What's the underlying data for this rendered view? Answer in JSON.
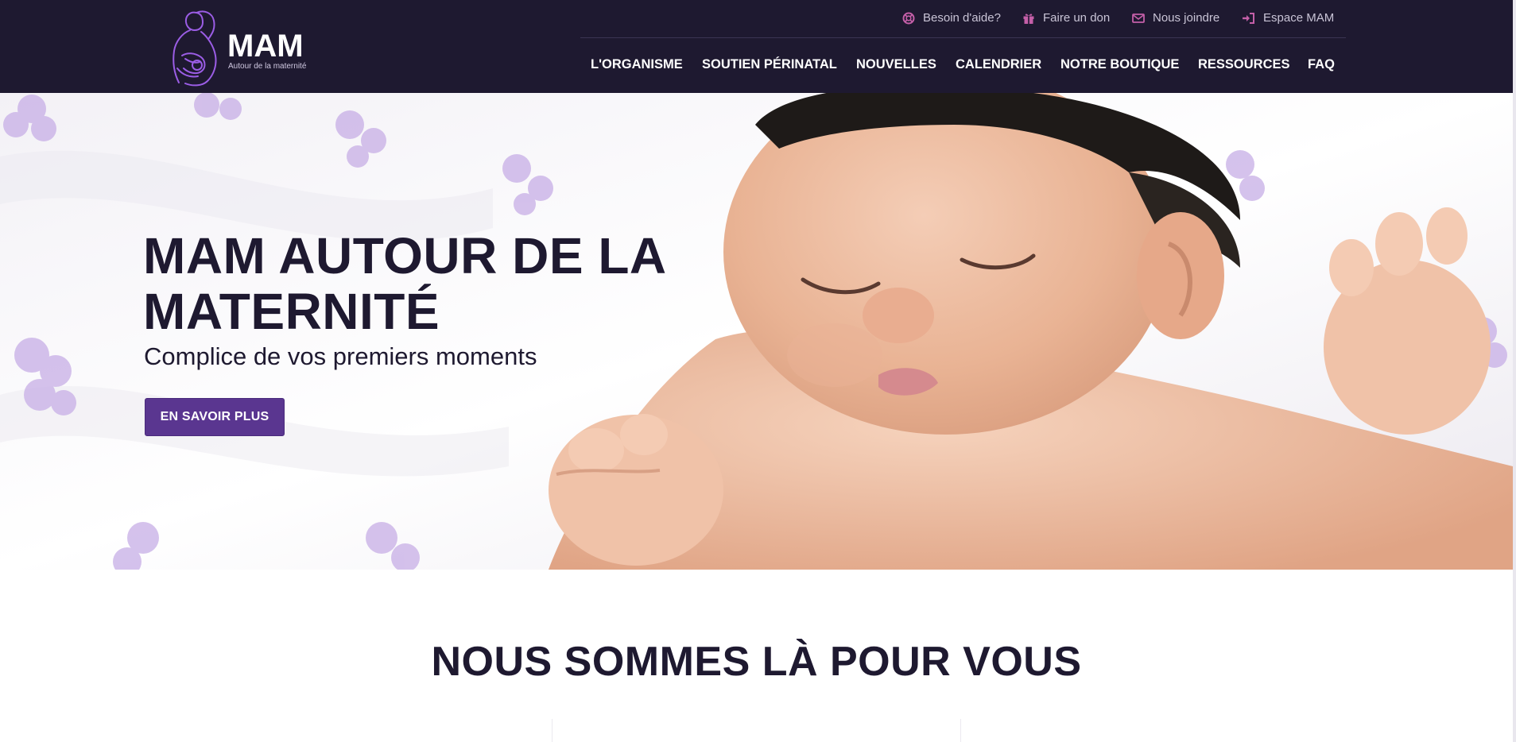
{
  "brand": {
    "name": "MAM",
    "tagline": "Autour de la maternité",
    "colors": {
      "dark": "#1e1930",
      "accent": "#5a3690",
      "icon_pink": "#c45fa8"
    }
  },
  "utility_nav": [
    {
      "label": "Besoin d'aide?",
      "icon": "lifebuoy-icon"
    },
    {
      "label": "Faire un don",
      "icon": "gift-icon"
    },
    {
      "label": "Nous joindre",
      "icon": "envelope-icon"
    },
    {
      "label": "Espace MAM",
      "icon": "sign-in-icon"
    }
  ],
  "main_nav": [
    {
      "label": "L'ORGANISME"
    },
    {
      "label": "SOUTIEN PÉRINATAL"
    },
    {
      "label": "NOUVELLES"
    },
    {
      "label": "CALENDRIER"
    },
    {
      "label": "NOTRE BOUTIQUE"
    },
    {
      "label": "RESSOURCES"
    },
    {
      "label": "FAQ"
    }
  ],
  "hero": {
    "title": "MAM AUTOUR DE LA MATERNITÉ",
    "subtitle": "Complice de vos premiers moments",
    "cta_label": "EN SAVOIR PLUS"
  },
  "section": {
    "title": "NOUS SOMMES LÀ POUR VOUS"
  }
}
